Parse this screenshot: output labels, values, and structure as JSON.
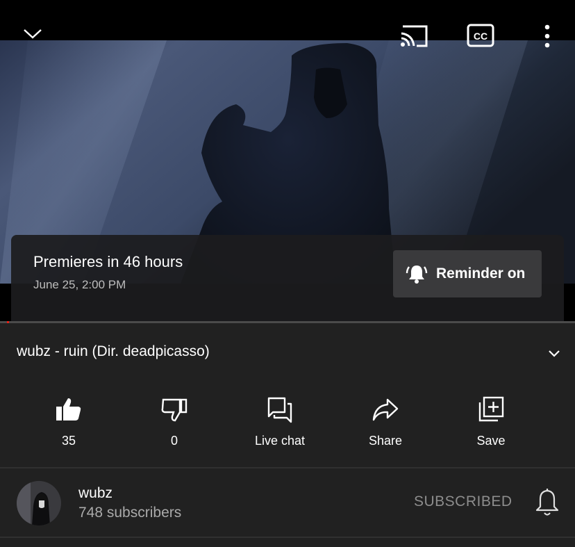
{
  "video": {
    "top_icons": [
      "chevron-down-icon",
      "cast-icon",
      "closed-captions-icon",
      "more-vert-icon"
    ],
    "premiere": {
      "title": "Premieres in 46 hours",
      "date": "June 25, 2:00 PM",
      "reminder_label": "Reminder on",
      "reminder_icon": "bell-ringing-icon"
    },
    "progress_color": "#e62117"
  },
  "title": {
    "text": "wubz - ruin (Dir. deadpicasso)",
    "expand_icon": "chevron-down-icon"
  },
  "actions": [
    {
      "icon": "thumbs-up-icon",
      "label": "35"
    },
    {
      "icon": "thumbs-down-icon",
      "label": "0"
    },
    {
      "icon": "live-chat-icon",
      "label": "Live chat"
    },
    {
      "icon": "share-icon",
      "label": "Share"
    },
    {
      "icon": "save-playlist-icon",
      "label": "Save"
    }
  ],
  "channel": {
    "name": "wubz",
    "subscribers": "748 subscribers",
    "subscribe_label": "SUBSCRIBED",
    "bell_icon": "notification-bell-icon"
  }
}
